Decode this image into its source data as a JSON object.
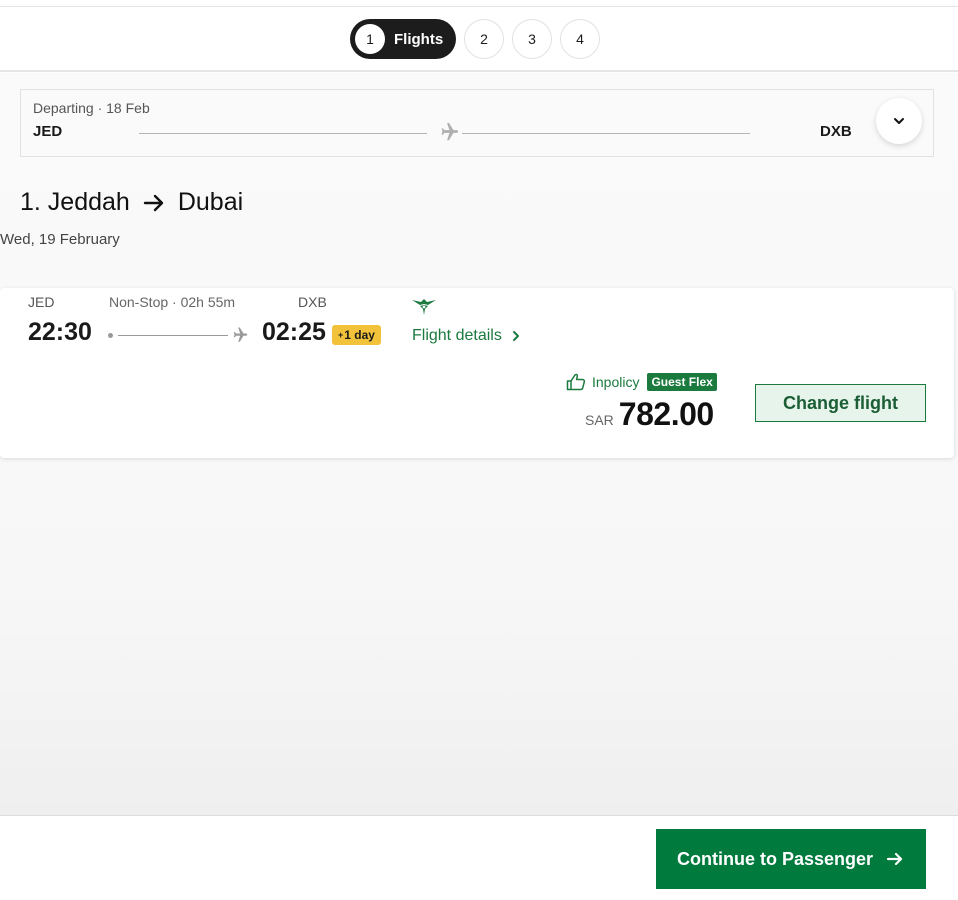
{
  "stepper": {
    "steps": [
      {
        "number": "1",
        "label": "Flights",
        "active": true
      },
      {
        "number": "2"
      },
      {
        "number": "3"
      },
      {
        "number": "4"
      }
    ]
  },
  "route_summary": {
    "departing_label": "Departing · 18 Feb",
    "origin": "JED",
    "destination": "DXB",
    "icons": [
      "plane-icon",
      "chevron-down-icon"
    ]
  },
  "leg": {
    "number_title": "1. Jeddah",
    "destination_title": "Dubai",
    "date": "Wed, 19 February"
  },
  "flight": {
    "origin": "JED",
    "destination": "DXB",
    "stops_duration": "Non-Stop · 02h 55m",
    "departure_time": "22:30",
    "arrival_time": "02:25",
    "day_offset_plus": "+",
    "day_offset": "1 day",
    "details_link": "Flight details",
    "policy": "Inpolicy",
    "fare_badge": "Guest Flex",
    "currency": "SAR",
    "price": "782.00",
    "change_button": "Change flight"
  },
  "footer": {
    "continue_button": "Continue to Passenger"
  },
  "colors": {
    "brand_green": "#007a3d",
    "text_green": "#1b7a3e",
    "day_badge": "#f2c23a",
    "dark": "#1c1c1c"
  }
}
